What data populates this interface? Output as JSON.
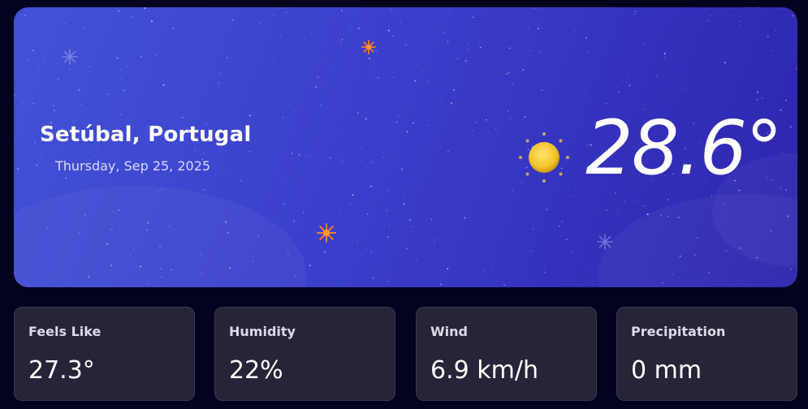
{
  "hero": {
    "location": "Setúbal, Portugal",
    "date": "Thursday, Sep 25, 2025",
    "temperature": "28.6°",
    "condition_icon": "sun-icon"
  },
  "cards": [
    {
      "label": "Feels Like",
      "value": "27.3°"
    },
    {
      "label": "Humidity",
      "value": "22%"
    },
    {
      "label": "Wind",
      "value": "6.9 km/h"
    },
    {
      "label": "Precipitation",
      "value": "0 mm"
    }
  ],
  "colors": {
    "page_background": "#03021f",
    "hero_gradient_start": "#4352d6",
    "hero_gradient_end": "#2e24ad",
    "card_background": "#262438",
    "sparkle_orange": "#ff7a1a",
    "sun_yellow": "#f2c42c"
  }
}
